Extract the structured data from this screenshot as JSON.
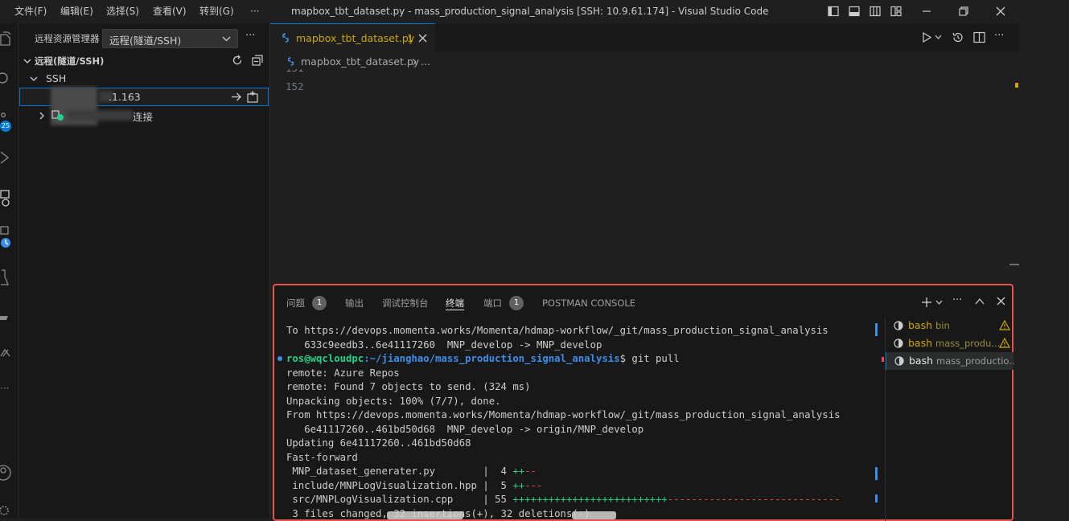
{
  "menu": [
    "文件(F)",
    "编辑(E)",
    "选择(S)",
    "查看(V)",
    "转到(G)",
    "···"
  ],
  "window_title": "mapbox_tbt_dataset.py - mass_production_signal_analysis [SSH: 10.9.61.174] - Visual Studio Code",
  "activity": {
    "badge_count": "25"
  },
  "sidebar": {
    "title": "远程资源管理器",
    "select_value": "远程(隧道/SSH)",
    "section": "远程(隧道/SSH)",
    "group": "SSH",
    "host1": ".1.163",
    "host2_label": "连接"
  },
  "editor": {
    "tab_label": "mapbox_tbt_dataset.py",
    "tab_badge": "1",
    "breadcrumb_file": "mapbox_tbt_dataset.py",
    "breadcrumb_more": "...",
    "line_numbers": [
      "151",
      "152"
    ]
  },
  "panel": {
    "tabs": [
      "问题",
      "输出",
      "调试控制台",
      "终端",
      "端口",
      "POSTMAN CONSOLE"
    ],
    "problems_count": "1",
    "ports_count": "1",
    "terminal_lines": [
      "To https://devops.momenta.works/Momenta/hdmap-workflow/_git/mass_production_signal_analysis",
      "   633c9eedb3..6e41117260  MNP_develop -> MNP_develop",
      "",
      "remote: Azure Repos",
      "remote: Found 7 objects to send. (324 ms)",
      "Unpacking objects: 100% (7/7), done.",
      "From https://devops.momenta.works/Momenta/hdmap-workflow/_git/mass_production_signal_analysis",
      "   6e41117260..461bd50d68  MNP_develop -> origin/MNP_develop",
      "Updating 6e41117260..461bd50d68",
      "Fast-forward"
    ],
    "prompt_user": "ros@wqcloudpc",
    "prompt_path": ":~/jianghao/mass_production_signal_analysis",
    "prompt_cmd": "$ git pull",
    "diffstat": [
      {
        "file": " MNP_dataset_generater.py        ",
        "count": "|  4 ",
        "plus": "++",
        "minus": "--"
      },
      {
        "file": " include/MNPLogVisualization.hpp ",
        "count": "|  5 ",
        "plus": "++",
        "minus": "---"
      },
      {
        "file": " src/MNPLogVisualization.cpp     ",
        "count": "| 55 ",
        "plus": "++++++++++++++++++++++++++",
        "minus": "-----------------------------"
      }
    ],
    "summary_line": " 3 files changed, 32 insertions(+), 32 deletions(-)",
    "terminals": [
      {
        "name": "bash",
        "desc": "bin",
        "warn": true
      },
      {
        "name": "bash",
        "desc": "mass_produ...",
        "warn": true
      },
      {
        "name": "bash",
        "desc": "mass_productio...",
        "warn": false
      }
    ]
  },
  "colors": {
    "accent": "#0078d4",
    "panel_border": "#e5534b",
    "green": "#23d18b",
    "blue": "#3b8eea",
    "red": "#f14c4c",
    "warning": "#cca700"
  }
}
